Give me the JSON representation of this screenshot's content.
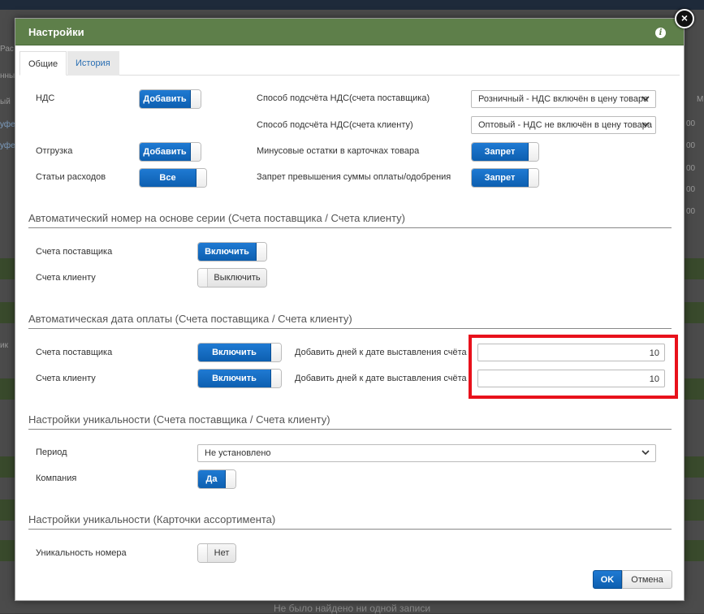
{
  "background": {
    "fragments": [
      "Рас",
      "нны",
      "ый",
      "уфе",
      "уфе",
      "ик",
      "M",
      "00",
      "00",
      "00",
      "00",
      "00"
    ],
    "empty_message": "Не было найдено ни одной записи"
  },
  "dialog": {
    "title": "Настройки",
    "close_symbol": "×",
    "info_symbol": "i"
  },
  "tabs": [
    {
      "label": "Общие",
      "active": true
    },
    {
      "label": "История",
      "active": false
    }
  ],
  "general": {
    "vat": {
      "label": "НДС",
      "toggle": "Добавить"
    },
    "shipment": {
      "label": "Отгрузка",
      "toggle": "Добавить"
    },
    "expenses": {
      "label": "Статьи расходов",
      "toggle": "Все"
    },
    "vat_method_supplier": {
      "label": "Способ подсчёта НДС(счета поставщика)",
      "value": "Розничный - НДС включён в цену товара"
    },
    "vat_method_client": {
      "label": "Способ подсчёта НДС(счета клиенту)",
      "value": "Оптовый - НДС не включён в цену товара"
    },
    "negative_stock": {
      "label": "Минусовые остатки в карточках товара",
      "toggle": "Запрет"
    },
    "overpay_ban": {
      "label": "Запрет превышения суммы оплаты/одобрения",
      "toggle": "Запрет"
    }
  },
  "auto_number": {
    "title": "Автоматический номер на основе серии (Счета поставщика / Счета клиенту)",
    "supplier": {
      "label": "Счета поставщика",
      "toggle": "Включить",
      "state": "on"
    },
    "client": {
      "label": "Счета клиенту",
      "toggle": "Выключить",
      "state": "off"
    }
  },
  "auto_date": {
    "title": "Автоматическая дата оплаты (Счета поставщика / Счета клиенту)",
    "supplier": {
      "label": "Счета поставщика",
      "toggle": "Включить",
      "days_label": "Добавить дней к дате выставления счёта",
      "days": "10"
    },
    "client": {
      "label": "Счета клиенту",
      "toggle": "Включить",
      "days_label": "Добавить дней к дате выставления счёта",
      "days": "10"
    }
  },
  "uniqueness_invoices": {
    "title": "Настройки уникальности (Счета поставщика / Счета клиенту)",
    "period": {
      "label": "Период",
      "value": "Не установлено"
    },
    "company": {
      "label": "Компания",
      "toggle": "Да"
    }
  },
  "uniqueness_assortment": {
    "title": "Настройки уникальности (Карточки ассортимента)",
    "number": {
      "label": "Уникальность номера",
      "toggle": "Нет"
    }
  },
  "footer": {
    "ok": "OK",
    "cancel": "Отмена"
  },
  "colors": {
    "header": "#5e7f4a",
    "primary": "#0d5fb0",
    "highlight": "#e8111b"
  }
}
